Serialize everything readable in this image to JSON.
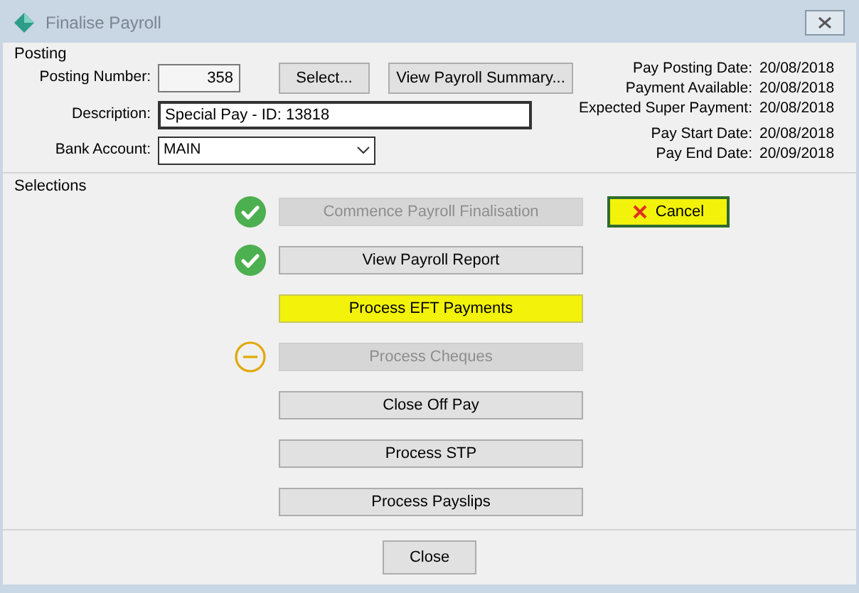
{
  "window": {
    "title": "Finalise Payroll"
  },
  "posting": {
    "title": "Posting",
    "posting_number": {
      "label": "Posting Number:",
      "value": "358"
    },
    "select_button": "Select...",
    "summary_button": "View Payroll Summary...",
    "description": {
      "label": "Description:",
      "value": "Special Pay - ID: 13818"
    },
    "bank_account": {
      "label": "Bank Account:",
      "value": "MAIN"
    },
    "dates": [
      {
        "label": "Pay Posting Date:",
        "value": "20/08/2018"
      },
      {
        "label": "Payment Available:",
        "value": "20/08/2018"
      },
      {
        "label": "Expected Super Payment:",
        "value": "20/08/2018"
      },
      {
        "label": "Pay Start Date:",
        "value": "20/08/2018"
      },
      {
        "label": "Pay End Date:",
        "value": "20/09/2018"
      }
    ]
  },
  "selections": {
    "title": "Selections",
    "steps": [
      {
        "label": "Commence Payroll Finalisation",
        "kind": "done",
        "disabled": true,
        "highlighted": false
      },
      {
        "label": "View Payroll Report",
        "kind": "done",
        "disabled": false,
        "highlighted": false
      },
      {
        "label": "Process EFT Payments",
        "kind": "none",
        "disabled": false,
        "highlighted": true
      },
      {
        "label": "Process Cheques",
        "kind": "skipped",
        "disabled": true,
        "highlighted": false
      },
      {
        "label": "Close Off Pay",
        "kind": "none",
        "disabled": false,
        "highlighted": false
      },
      {
        "label": "Process STP",
        "kind": "none",
        "disabled": false,
        "highlighted": false
      },
      {
        "label": "Process Payslips",
        "kind": "none",
        "disabled": false,
        "highlighted": false
      }
    ],
    "cancel_button": {
      "label": "Cancel",
      "highlighted": true
    }
  },
  "close_button": "Close"
}
